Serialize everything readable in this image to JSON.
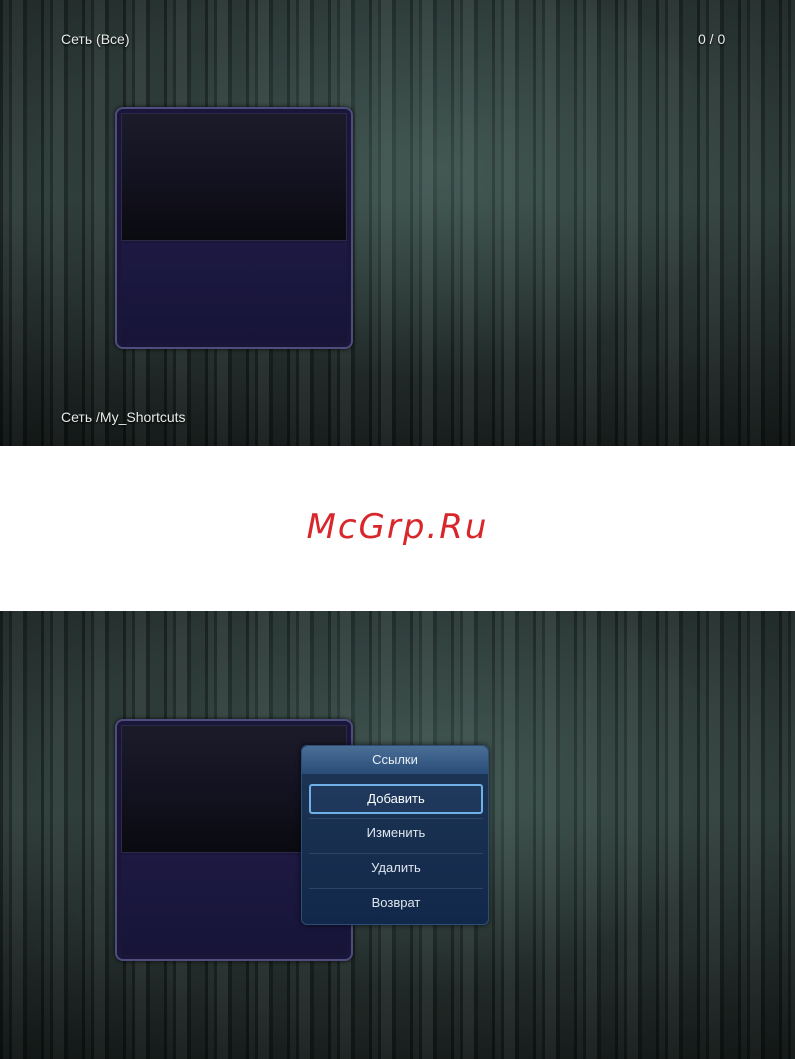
{
  "top_screen": {
    "title": "Сеть (Все)",
    "counter": "0 / 0",
    "path": "Сеть /My_Shortcuts"
  },
  "watermark": "McGrp.Ru",
  "bottom_screen": {
    "menu": {
      "title": "Ссылки",
      "items": [
        {
          "label": "Добавить",
          "selected": true
        },
        {
          "label": "Изменить",
          "selected": false
        },
        {
          "label": "Удалить",
          "selected": false
        },
        {
          "label": "Возврат",
          "selected": false
        }
      ]
    }
  },
  "colors": {
    "watermark": "#d8262a",
    "selection_border": "#6fb0e6",
    "menu_background": "#12284a"
  }
}
